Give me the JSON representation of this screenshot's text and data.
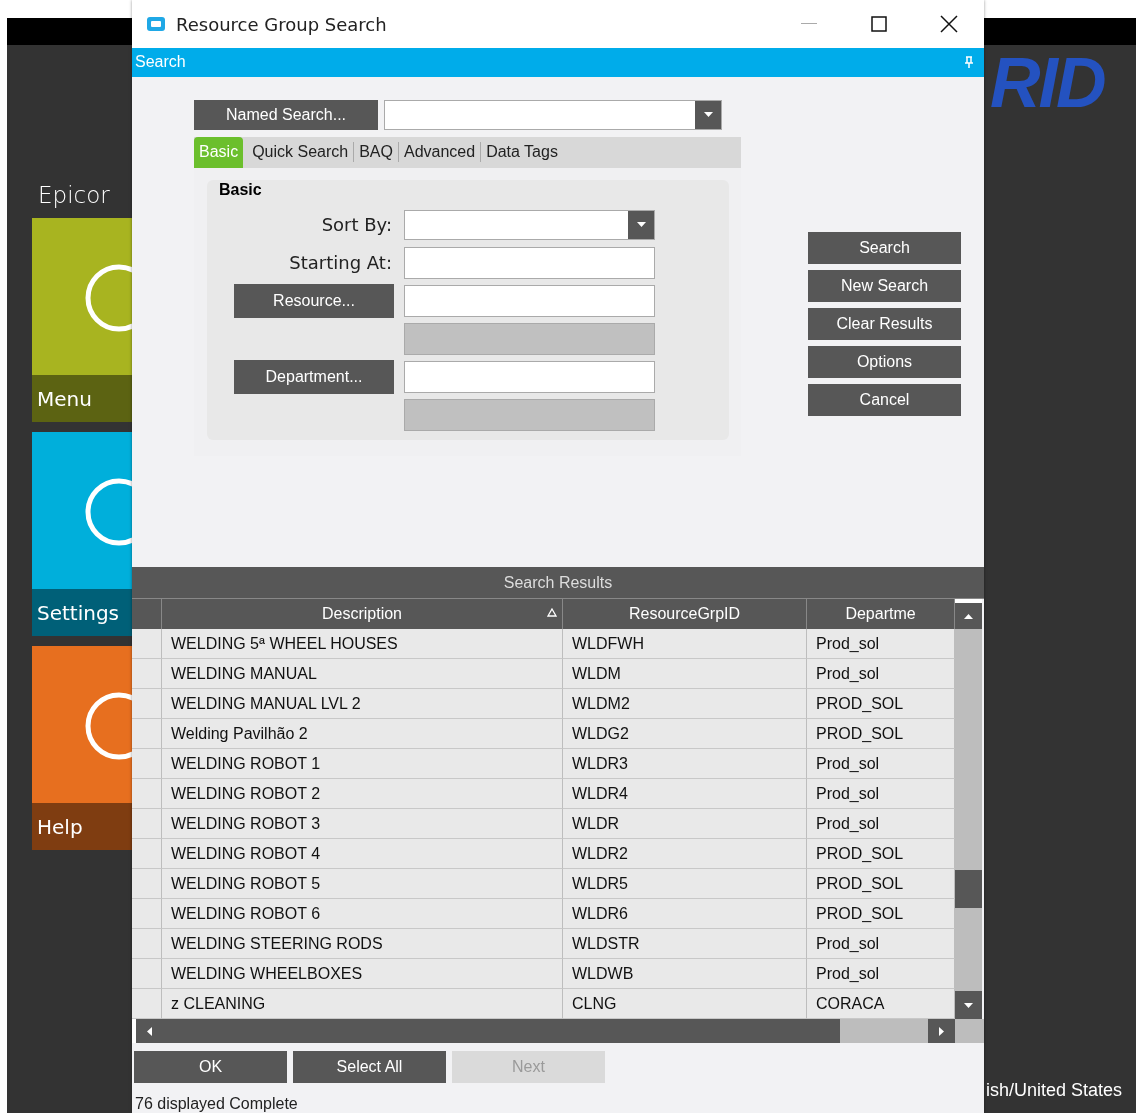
{
  "background": {
    "brand": "Epicor",
    "logo_text": "RID",
    "locale": "ish/United States",
    "tiles": [
      {
        "label": "Menu",
        "color": "#a8b420"
      },
      {
        "label": "Settings",
        "color": "#00afdb"
      },
      {
        "label": "Help",
        "color": "#e76f1f"
      }
    ]
  },
  "window": {
    "title": "Resource Group Search"
  },
  "panel": {
    "title": "Search"
  },
  "named_search_button": "Named Search...",
  "tabs": [
    {
      "label": "Basic",
      "selected": true
    },
    {
      "label": "Quick Search",
      "selected": false
    },
    {
      "label": "BAQ",
      "selected": false
    },
    {
      "label": "Advanced",
      "selected": false
    },
    {
      "label": "Data Tags",
      "selected": false
    }
  ],
  "basic_group": {
    "title": "Basic",
    "fields": [
      {
        "kind": "combo",
        "label": "Sort By:"
      },
      {
        "kind": "text",
        "label": "Starting At:"
      },
      {
        "kind": "lookup",
        "label": "Resource..."
      },
      {
        "kind": "readonly"
      },
      {
        "kind": "lookup",
        "label": "Department..."
      },
      {
        "kind": "readonly"
      }
    ]
  },
  "actions": [
    "Search",
    "New Search",
    "Clear Results",
    "Options",
    "Cancel"
  ],
  "results": {
    "title": "Search Results",
    "columns": [
      {
        "label": "Description",
        "sorted": true
      },
      {
        "label": "ResourceGrpID",
        "sorted": false
      },
      {
        "label": "Departme",
        "sorted": false
      }
    ],
    "rows": [
      [
        "WELDING 5ª WHEEL HOUSES",
        "WLDFWH",
        "Prod_sol"
      ],
      [
        "WELDING MANUAL",
        "WLDM",
        "Prod_sol"
      ],
      [
        "WELDING MANUAL LVL 2",
        "WLDM2",
        "PROD_SOL"
      ],
      [
        "Welding Pavilhão 2",
        "WLDG2",
        "PROD_SOL"
      ],
      [
        "WELDING ROBOT 1",
        "WLDR3",
        "Prod_sol"
      ],
      [
        "WELDING ROBOT 2",
        "WLDR4",
        "Prod_sol"
      ],
      [
        "WELDING ROBOT 3",
        "WLDR",
        "Prod_sol"
      ],
      [
        "WELDING ROBOT 4",
        "WLDR2",
        "PROD_SOL"
      ],
      [
        "WELDING ROBOT 5",
        "WLDR5",
        "PROD_SOL"
      ],
      [
        "WELDING ROBOT 6",
        "WLDR6",
        "PROD_SOL"
      ],
      [
        "WELDING STEERING RODS",
        "WLDSTR",
        "Prod_sol"
      ],
      [
        "WELDING WHEELBOXES",
        "WLDWB",
        "Prod_sol"
      ],
      [
        "z CLEANING",
        "CLNG",
        "CORACA"
      ]
    ]
  },
  "footer_buttons": [
    {
      "label": "OK",
      "disabled": false
    },
    {
      "label": "Select All",
      "disabled": false
    },
    {
      "label": "Next",
      "disabled": true
    }
  ],
  "status_bar": "76 displayed Complete"
}
